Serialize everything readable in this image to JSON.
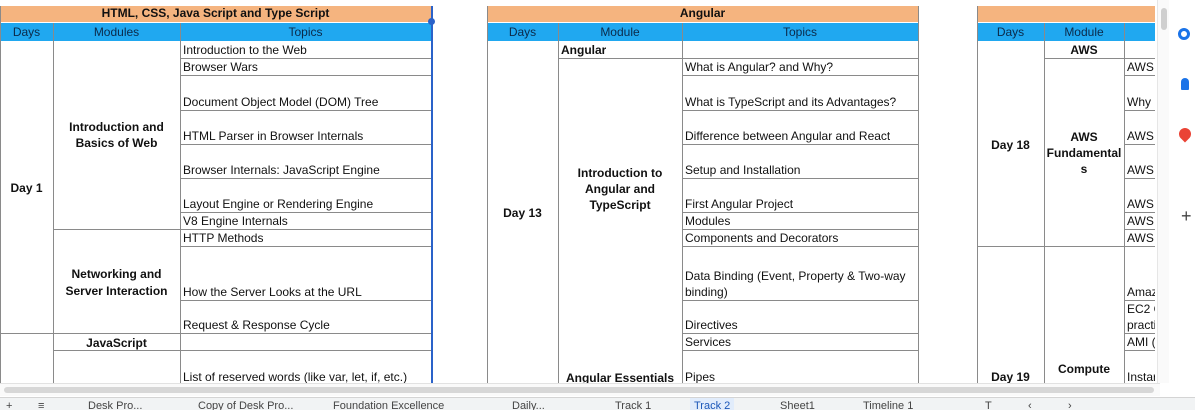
{
  "table1": {
    "title": "HTML, CSS, Java Script and Type Script",
    "col_days": "Days",
    "col_modules": "Modules",
    "col_topics": "Topics",
    "day": "Day 1",
    "module_intro": [
      "Introduction and",
      "Basics of Web"
    ],
    "module_network": [
      "Networking and",
      "Server Interaction"
    ],
    "module_js": "JavaScript",
    "topics": [
      "Introduction to the Web",
      "Browser Wars",
      "Document Object Model (DOM) Tree",
      "HTML Parser in Browser Internals",
      "Browser Internals: JavaScript Engine",
      "Layout Engine or Rendering Engine",
      "V8 Engine Internals",
      "HTTP Methods",
      "How the Server Looks at the URL",
      "Request & Response Cycle",
      "List of reserved words (like var, let, if, etc.)"
    ]
  },
  "table2": {
    "title": "Angular",
    "col_days": "Days",
    "col_module": "Module",
    "col_topics": "Topics",
    "section": "Angular",
    "day": "Day 13",
    "module_intro": [
      "Introduction to",
      "Angular and",
      "TypeScript"
    ],
    "module_essentials": "Angular Essentials",
    "topics": [
      "What is Angular? and Why?",
      "What is TypeScript and its Advantages?",
      "Difference between Angular and React",
      "Setup and Installation",
      "First Angular Project",
      "Modules",
      "Components and Decorators",
      "Data Binding (Event, Property & Two-way",
      "binding)",
      "Directives",
      "Services",
      "Pipes"
    ]
  },
  "table3": {
    "col_days": "Days",
    "col_module": "Module",
    "section": "AWS",
    "day18": "Day 18",
    "day19": "Day 19",
    "module_aws": [
      "AWS",
      "Fundamental",
      "s"
    ],
    "module_compute": "Compute",
    "topics": [
      "AWS",
      "Why",
      "AWS",
      "AWS",
      "AWS",
      "AWS",
      "AWS",
      "Amaz",
      "EC2 C",
      "practi",
      "AMI (",
      "Instar"
    ]
  },
  "tabs": [
    "Desk Pro...",
    "Copy of Desk Pro...",
    "Foundation Excellence",
    "Daily...",
    "Track 1",
    "Track 2",
    "Sheet1",
    "Timeline 1",
    "T"
  ]
}
